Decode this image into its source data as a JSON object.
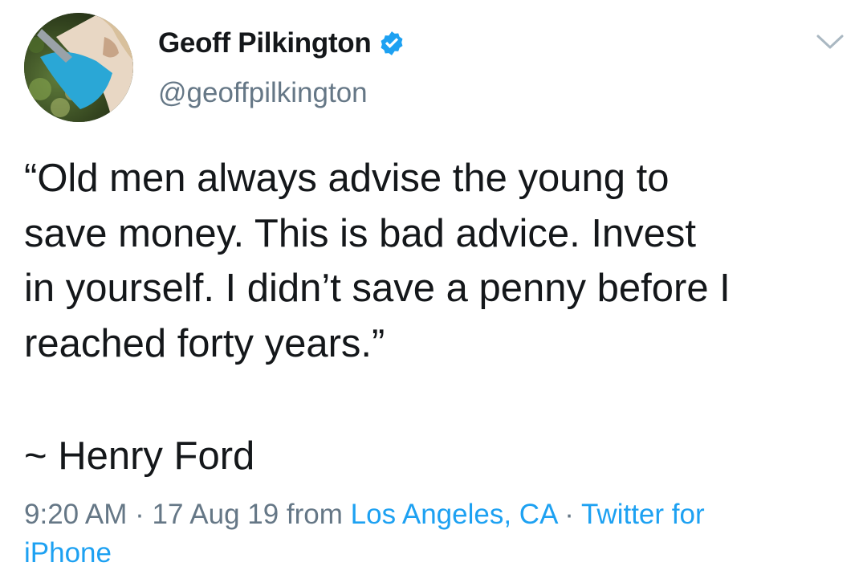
{
  "author": {
    "display_name": "Geoff Pilkington",
    "handle": "@geoffpilkington",
    "verified": true,
    "avatar_icon": "profile-photo"
  },
  "menu_icon": "chevron-down-icon",
  "tweet": {
    "lines": [
      "“Old men always advise the young to",
      "save money. This is bad advice. Invest",
      "in yourself. I didn’t save a penny before I",
      "reached forty years.”"
    ],
    "attribution": "~ Henry Ford"
  },
  "meta": {
    "time": "9:20 AM",
    "separator": " · ",
    "date": "17 Aug 19",
    "from_label": " from ",
    "location": "Los Angeles, CA",
    "separator2": " · ",
    "source_part1": "Twitter for",
    "source_part2": "iPhone"
  },
  "colors": {
    "text": "#14171a",
    "secondary": "#657786",
    "link": "#1da1f2",
    "verified": "#1da1f2",
    "background": "#ffffff"
  }
}
